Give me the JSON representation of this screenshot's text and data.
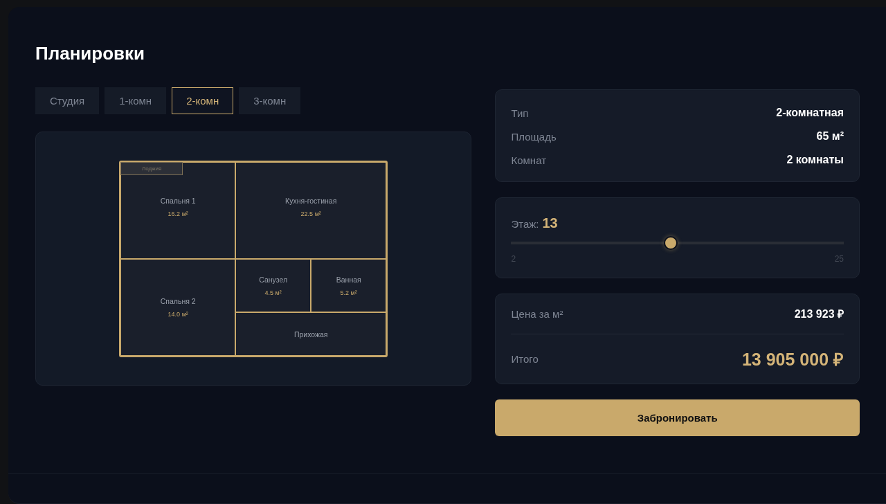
{
  "title": "Планировки",
  "tabs": [
    {
      "label": "Студия",
      "selected": false
    },
    {
      "label": "1-комн",
      "selected": false
    },
    {
      "label": "2-комн",
      "selected": true
    },
    {
      "label": "3-комн",
      "selected": false
    }
  ],
  "plan": {
    "balcony": "Лоджия",
    "rooms": [
      {
        "name": "Спальня 1",
        "area": "16.2 м²"
      },
      {
        "name": "Кухня-гостиная",
        "area": "22.5 м²"
      },
      {
        "name": "Спальня 2",
        "area": "14.0 м²"
      },
      {
        "name": "Санузел",
        "area": "4.5 м²"
      },
      {
        "name": "Ванная",
        "area": "5.2 м²"
      },
      {
        "name": "Прихожая"
      }
    ]
  },
  "specs": [
    {
      "label": "Тип",
      "value": "2-комнатная"
    },
    {
      "label": "Площадь",
      "value": "65 м²"
    },
    {
      "label": "Комнат",
      "value": "2 комнаты"
    }
  ],
  "floor": {
    "label": "Этаж:",
    "value": "13",
    "level": 0.478,
    "min": "2",
    "max": "25"
  },
  "price": {
    "per_m2_label": "Цена за м²",
    "per_m2": "213 923 ₽",
    "total_label": "Итого",
    "total": "13 905 000 ₽"
  },
  "book_button": "Забронировать"
}
